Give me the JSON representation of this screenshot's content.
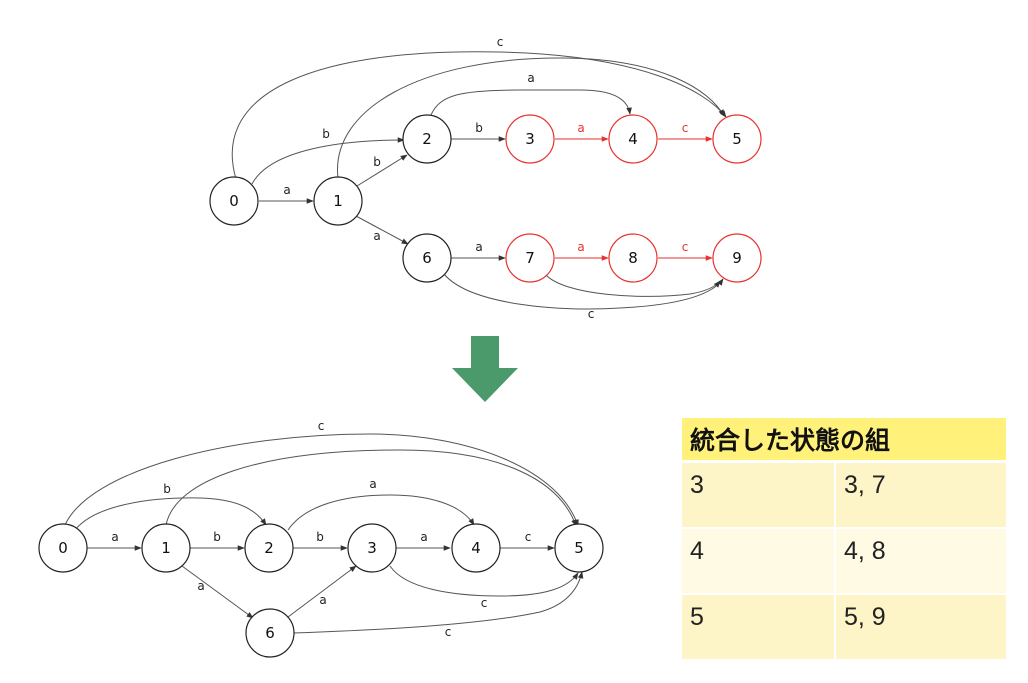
{
  "top_graph": {
    "nodes": [
      {
        "id": "t0",
        "label": "0",
        "highlight": false
      },
      {
        "id": "t1",
        "label": "1",
        "highlight": false
      },
      {
        "id": "t2",
        "label": "2",
        "highlight": false
      },
      {
        "id": "t3",
        "label": "3",
        "highlight": true
      },
      {
        "id": "t4",
        "label": "4",
        "highlight": true
      },
      {
        "id": "t5",
        "label": "5",
        "highlight": true
      },
      {
        "id": "t6",
        "label": "6",
        "highlight": false
      },
      {
        "id": "t7",
        "label": "7",
        "highlight": true
      },
      {
        "id": "t8",
        "label": "8",
        "highlight": true
      },
      {
        "id": "t9",
        "label": "9",
        "highlight": true
      }
    ],
    "edges": [
      {
        "from": "0",
        "to": "1",
        "label": "a",
        "highlight": false
      },
      {
        "from": "0",
        "to": "2",
        "label": "b",
        "highlight": false
      },
      {
        "from": "0",
        "to": "5",
        "label": "c",
        "highlight": false
      },
      {
        "from": "1",
        "to": "2",
        "label": "b",
        "highlight": false
      },
      {
        "from": "1",
        "to": "5",
        "label": "",
        "highlight": false
      },
      {
        "from": "1",
        "to": "6",
        "label": "a",
        "highlight": false
      },
      {
        "from": "2",
        "to": "3",
        "label": "b",
        "highlight": false
      },
      {
        "from": "2",
        "to": "4",
        "label": "a",
        "highlight": false
      },
      {
        "from": "3",
        "to": "4",
        "label": "a",
        "highlight": true
      },
      {
        "from": "4",
        "to": "5",
        "label": "c",
        "highlight": true
      },
      {
        "from": "6",
        "to": "7",
        "label": "a",
        "highlight": false
      },
      {
        "from": "6",
        "to": "9",
        "label": "c",
        "highlight": false
      },
      {
        "from": "7",
        "to": "8",
        "label": "a",
        "highlight": true
      },
      {
        "from": "7",
        "to": "9",
        "label": "",
        "highlight": false
      },
      {
        "from": "8",
        "to": "9",
        "label": "c",
        "highlight": true
      }
    ]
  },
  "bottom_graph": {
    "nodes": [
      {
        "id": "b0",
        "label": "0"
      },
      {
        "id": "b1",
        "label": "1"
      },
      {
        "id": "b2",
        "label": "2"
      },
      {
        "id": "b3",
        "label": "3"
      },
      {
        "id": "b4",
        "label": "4"
      },
      {
        "id": "b5",
        "label": "5"
      },
      {
        "id": "b6",
        "label": "6"
      }
    ],
    "edges": [
      {
        "from": "0",
        "to": "1",
        "label": "a"
      },
      {
        "from": "0",
        "to": "2",
        "label": "b"
      },
      {
        "from": "0",
        "to": "5",
        "label": "c"
      },
      {
        "from": "1",
        "to": "2",
        "label": "b"
      },
      {
        "from": "1",
        "to": "5",
        "label": ""
      },
      {
        "from": "1",
        "to": "6",
        "label": "a"
      },
      {
        "from": "2",
        "to": "3",
        "label": "b"
      },
      {
        "from": "2",
        "to": "4",
        "label": "a"
      },
      {
        "from": "3",
        "to": "4",
        "label": "a"
      },
      {
        "from": "3",
        "to": "5",
        "label": "c"
      },
      {
        "from": "4",
        "to": "5",
        "label": "c"
      },
      {
        "from": "6",
        "to": "3",
        "label": "a"
      },
      {
        "from": "6",
        "to": "5",
        "label": "c"
      }
    ]
  },
  "arrow": {
    "icon": "down-arrow-icon",
    "color": "#4b9a6b"
  },
  "colors": {
    "highlight": "#e8322d",
    "node_stroke": "#222222",
    "edge": "#555555",
    "table_header": "#fff17a",
    "table_row": "#fdf4c8"
  },
  "table": {
    "header": "統合した状態の組",
    "rows": [
      {
        "state": "3",
        "merged": "3, 7"
      },
      {
        "state": "4",
        "merged": "4, 8"
      },
      {
        "state": "5",
        "merged": "5, 9"
      }
    ]
  }
}
